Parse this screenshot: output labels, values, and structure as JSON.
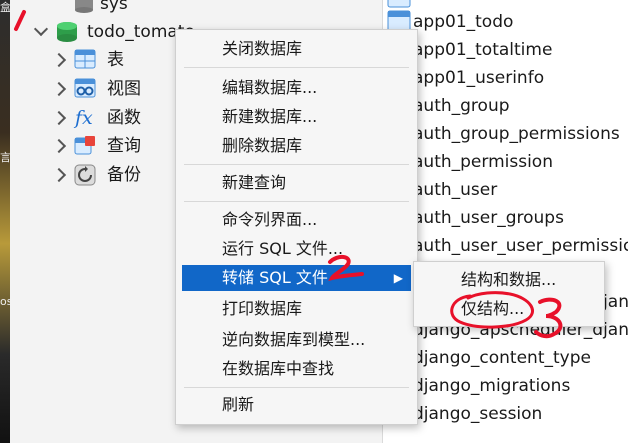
{
  "tree": {
    "db_sys": "sys",
    "db_todo": "todo_tomato",
    "nodes": [
      {
        "icon": "table-icon",
        "label": "表"
      },
      {
        "icon": "view-icon",
        "label": "视图"
      },
      {
        "icon": "function-icon",
        "label": "函数"
      },
      {
        "icon": "query-icon",
        "label": "查询"
      },
      {
        "icon": "backup-icon",
        "label": "备份"
      }
    ]
  },
  "tables": [
    "app01_todo",
    "app01_totaltime",
    "app01_userinfo",
    "auth_group",
    "auth_group_permissions",
    "auth_permission",
    "auth_user",
    "auth_user_groups",
    "auth_user_user_permissic",
    "django_apscheduler_djan",
    "django_apscheduler_djan",
    "django_content_type",
    "django_migrations",
    "django_session"
  ],
  "context_menu": {
    "items": [
      "关闭数据库",
      "编辑数据库...",
      "新建数据库...",
      "删除数据库",
      "新建查询",
      "命令列界面...",
      "运行 SQL 文件...",
      "转储 SQL 文件",
      "打印数据库",
      "逆向数据库到模型...",
      "在数据库中查找",
      "刷新"
    ]
  },
  "submenu": {
    "items": [
      "结构和数据...",
      "仅结构..."
    ]
  },
  "colors": {
    "highlight": "#1167c8",
    "annotation_red": "#e8112a",
    "db_icon_green": "#2e9e4a"
  }
}
